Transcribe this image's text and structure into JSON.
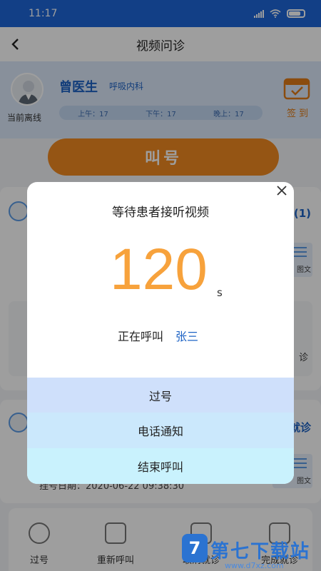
{
  "status_bar": {
    "time": "11:17"
  },
  "nav": {
    "title": "视频问诊"
  },
  "doctor": {
    "name": "曾医生",
    "department": "呼吸内科",
    "online_status": "当前离线",
    "counts": [
      {
        "label": "上午：17"
      },
      {
        "label": "下午：17"
      },
      {
        "label": "晚上：17"
      }
    ],
    "checkin_label": "签到"
  },
  "call_button_label": "叫号",
  "cards": {
    "card1_status": "(1)",
    "card1_badge": "图文",
    "card1_text": "诊",
    "card2_status": "就诊",
    "card2_badge": "图文",
    "card2_reg": "挂号日期：2020-06-22 09:38:30"
  },
  "actions": [
    {
      "label": "过号"
    },
    {
      "label": "重新呼叫"
    },
    {
      "label": "取消就诊"
    },
    {
      "label": "完成就诊"
    }
  ],
  "watermark": {
    "main": "第七下载站",
    "sub": "www.d7xz.com"
  },
  "modal": {
    "title": "等待患者接听视频",
    "countdown": "120",
    "unit": "s",
    "calling_label": "正在呼叫",
    "patient_name": "张三",
    "buttons": [
      {
        "label": "过号"
      },
      {
        "label": "电话通知"
      },
      {
        "label": "结束呼叫"
      }
    ]
  }
}
